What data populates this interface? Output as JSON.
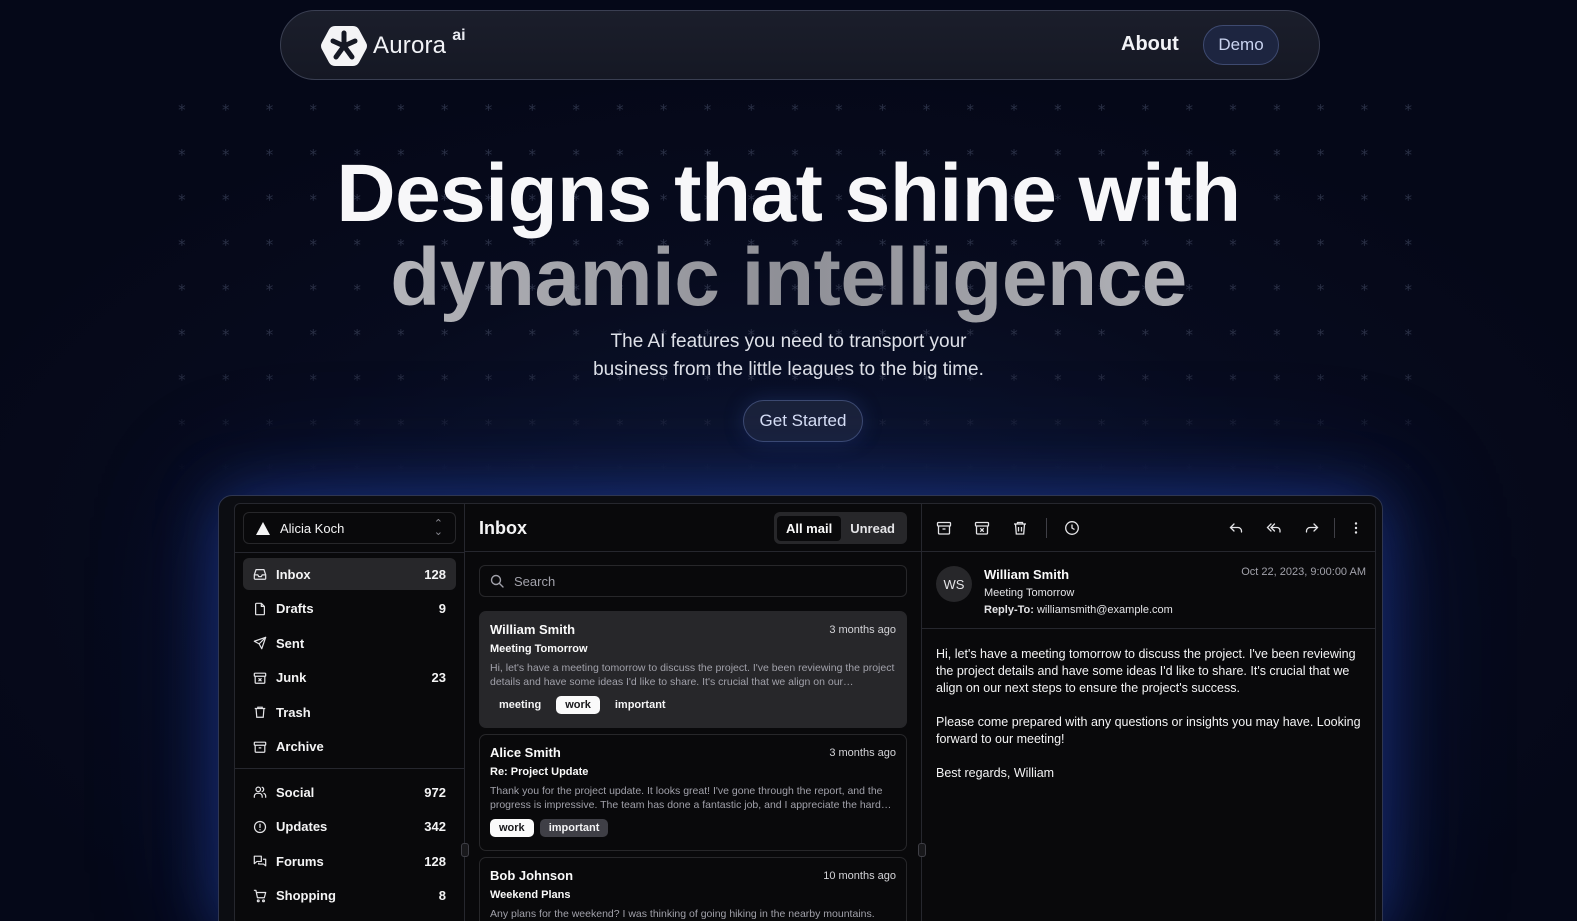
{
  "brand": {
    "name": "Aurora",
    "suffix": "ai",
    "icon": "asterisk-hexagon-icon"
  },
  "nav": {
    "about": "About",
    "demo": "Demo"
  },
  "hero": {
    "line1": "Designs that shine with",
    "line2": "dynamic intelligence",
    "sub1": "The AI features you need to transport your",
    "sub2": "business from the little leagues to the big time.",
    "cta": "Get Started"
  },
  "colors": {
    "background": "#060a1c",
    "accent": "#1d2540",
    "panel": "#09090b",
    "glow": "#2850c8"
  },
  "mail": {
    "account": "Alicia Koch",
    "folders": [
      {
        "label": "Inbox",
        "count": "128",
        "icon": "inbox-icon"
      },
      {
        "label": "Drafts",
        "count": "9",
        "icon": "file-icon"
      },
      {
        "label": "Sent",
        "count": "",
        "icon": "send-icon"
      },
      {
        "label": "Junk",
        "count": "23",
        "icon": "archive-x-icon"
      },
      {
        "label": "Trash",
        "count": "",
        "icon": "trash-icon"
      },
      {
        "label": "Archive",
        "count": "",
        "icon": "archive-icon"
      }
    ],
    "categories": [
      {
        "label": "Social",
        "count": "972",
        "icon": "users-icon"
      },
      {
        "label": "Updates",
        "count": "342",
        "icon": "alert-circle-icon"
      },
      {
        "label": "Forums",
        "count": "128",
        "icon": "messages-icon"
      },
      {
        "label": "Shopping",
        "count": "8",
        "icon": "cart-icon"
      }
    ],
    "list": {
      "title": "Inbox",
      "filters": [
        "All mail",
        "Unread"
      ],
      "search_placeholder": "Search",
      "items": [
        {
          "from": "William Smith",
          "when": "3 months ago",
          "subject": "Meeting Tomorrow",
          "preview": "Hi, let's have a meeting tomorrow to discuss the project. I've been reviewing the project details and have some ideas I'd like to share. It's crucial that we align on our…",
          "tags": [
            "meeting",
            "work",
            "important"
          ]
        },
        {
          "from": "Alice Smith",
          "when": "3 months ago",
          "subject": "Re: Project Update",
          "preview": "Thank you for the project update. It looks great! I've gone through the report, and the progress is impressive. The team has done a fantastic job, and I appreciate the hard…",
          "tags": [
            "work",
            "important"
          ]
        },
        {
          "from": "Bob Johnson",
          "when": "10 months ago",
          "subject": "Weekend Plans",
          "preview": "Any plans for the weekend? I was thinking of going hiking in the nearby mountains.",
          "tags": []
        }
      ]
    },
    "reader": {
      "initials": "WS",
      "sender": "William Smith",
      "subject": "Meeting Tomorrow",
      "reply_to_label": "Reply-To:",
      "reply_to": "williamsmith@example.com",
      "date": "Oct 22, 2023, 9:00:00 AM",
      "body": [
        "Hi, let's have a meeting tomorrow to discuss the project. I've been reviewing the project details and have some ideas I'd like to share. It's crucial that we align on our next steps to ensure the project's success.",
        "Please come prepared with any questions or insights you may have. Looking forward to our meeting!",
        "Best regards, William"
      ],
      "toolbar": [
        "archive-icon",
        "archive-x-icon",
        "trash-icon",
        "clock-icon",
        "reply-icon",
        "reply-all-icon",
        "forward-icon",
        "more-vertical-icon"
      ]
    }
  }
}
